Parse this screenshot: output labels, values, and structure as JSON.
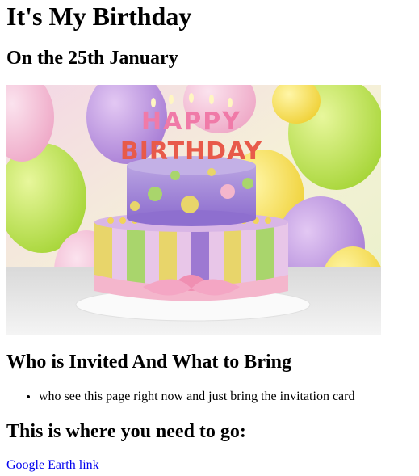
{
  "header": {
    "title": "It's My Birthday",
    "date_heading": "On the 25th January"
  },
  "image": {
    "description_icon": "birthday-cake-image",
    "cake_topper_line1": "HAPPY",
    "cake_topper_line2": "BIRTHDAY"
  },
  "invite": {
    "heading": "Who is Invited And What to Bring",
    "items": [
      "who see this page right now and just bring the invitation card"
    ]
  },
  "location": {
    "heading": "This is where you need to go:",
    "link_text": "Google Earth link"
  },
  "colors": {
    "link": "#0000ee",
    "text": "#000000",
    "background": "#ffffff"
  }
}
